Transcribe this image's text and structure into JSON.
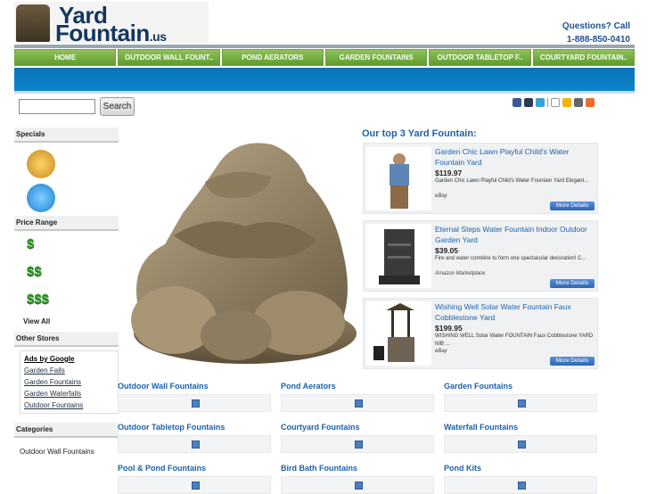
{
  "header": {
    "logo_line1": "Yard",
    "logo_line2": "Fountain",
    "logo_tld": ".us",
    "contact_label": "Questions? Call",
    "phone": "1-888-850-0410"
  },
  "nav": [
    "HOME",
    "OUTDOOR WALL FOUNT..",
    "POND AERATORS",
    "GARDEN FOUNTAINS",
    "OUTDOOR TABLETOP F..",
    "COURTYARD FOUNTAIN.."
  ],
  "search": {
    "button_label": "Search",
    "value": ""
  },
  "share_icons": [
    "facebook-icon",
    "myspace-icon",
    "twitter-icon",
    "mail-icon",
    "favorites-icon",
    "print-icon",
    "add-icon"
  ],
  "sidebar": {
    "specials_title": "Specials",
    "price_range_title": "Price Range",
    "prices": [
      "$",
      "$$",
      "$$$"
    ],
    "view_all": "View All",
    "other_stores_title": "Other Stores",
    "ads_heading": "Ads by Google",
    "ads_links": [
      "Garden Falls",
      "Garden Fountains",
      "Garden Waterfalls",
      "Outdoor Fountains"
    ],
    "categories_title": "Categories",
    "categories": [
      "Outdoor Wall Fountains"
    ]
  },
  "top3": {
    "title": "Our top 3 Yard Fountain:",
    "more_label": "More Details",
    "products": [
      {
        "title": "Garden Chic Lawn Playful Child's Water Fountain Yard",
        "price": "$119.97",
        "desc": "Garden Chic Lawn Playful Child's Water Fountain Yard Elegant...",
        "source": "eBay"
      },
      {
        "title": "Eternal Steps Water Fountain Indoor Outdoor Garden Yard",
        "price": "$39.05",
        "desc": "Fire and water combine to form one spectacular decoration! C...",
        "source": "Amazon Marketplace"
      },
      {
        "title": "Wishing Well Solar Water Fountain Faux Cobblestone Yard",
        "price": "$199.95",
        "desc": "WISHING WELL Solar Water FOUNTAIN Faux Cobblestone YARD NIB ...",
        "source": "eBay"
      }
    ]
  },
  "categories_grid": [
    "Outdoor Wall Fountains",
    "Pond Aerators",
    "Garden Fountains",
    "Outdoor Tabletop Fountains",
    "Courtyard Fountains",
    "Waterfall Fountains",
    "Pool & Pond Fountains",
    "Bird Bath Fountains",
    "Pond Kits"
  ],
  "colors": {
    "nav_green": "#5e9b2d",
    "banner_blue": "#0b72b8",
    "link_blue": "#1d62a8",
    "price_green": "#2f9a26"
  }
}
